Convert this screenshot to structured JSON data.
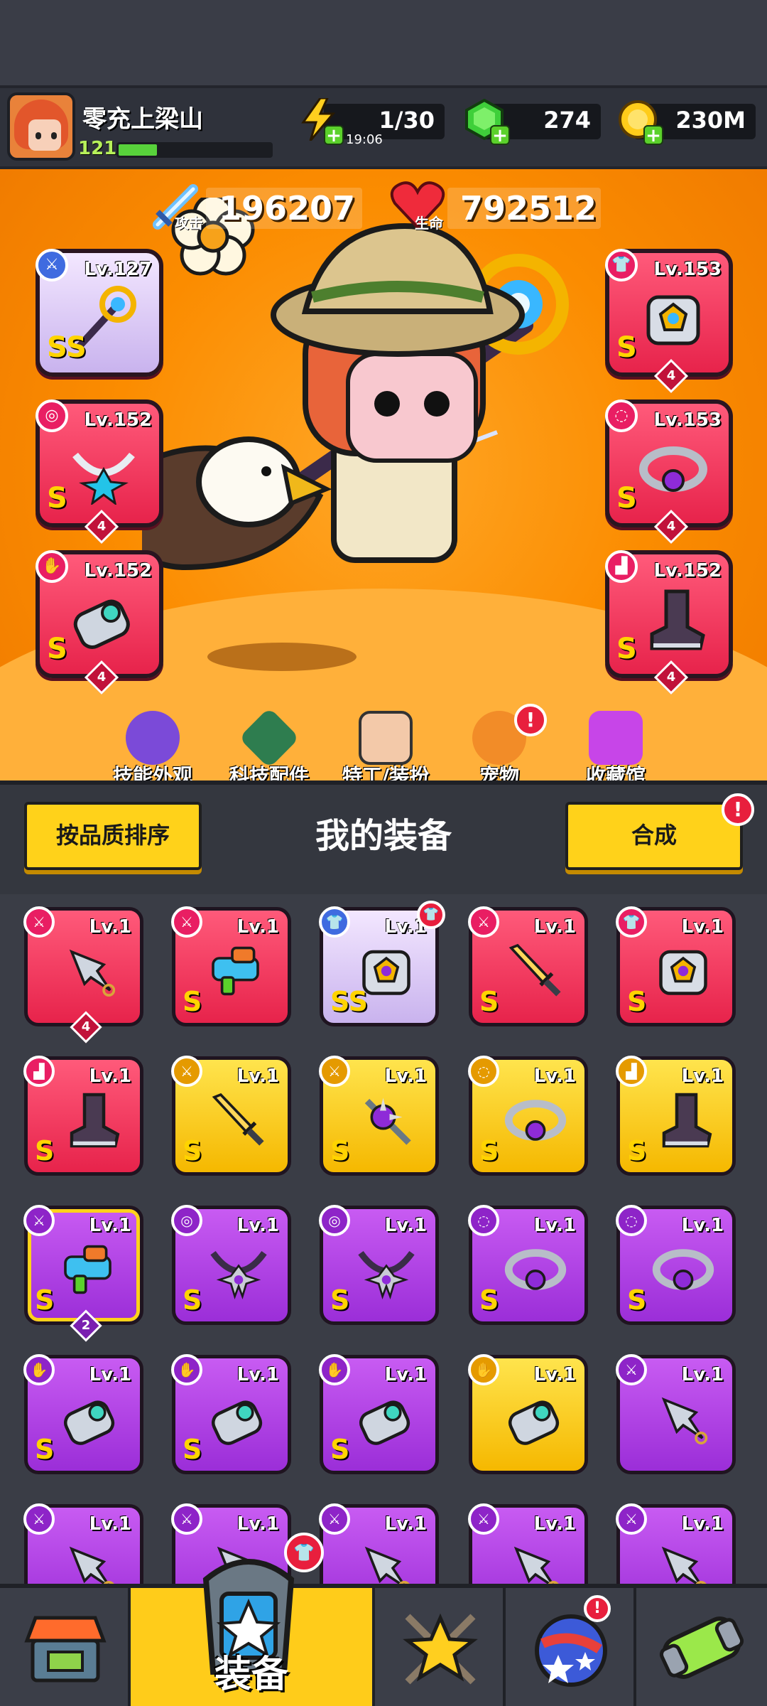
{
  "player": {
    "name": "零充上梁山",
    "level": "121",
    "xp_fraction": 0.25
  },
  "resources": {
    "energy": {
      "value": "1/30",
      "timer": "19:06",
      "icon": "lightning-icon"
    },
    "gems": {
      "value": "274",
      "icon": "green-gem-icon"
    },
    "coins": {
      "value": "230M",
      "icon": "gold-coin-icon"
    }
  },
  "stats": {
    "attack": {
      "label": "攻击",
      "value": "196207",
      "icon": "sword-icon"
    },
    "hp": {
      "label": "生命",
      "value": "792512",
      "icon": "heart-icon"
    }
  },
  "equipped": [
    {
      "slot": "weapon",
      "level": "Lv.127",
      "grade": "SS",
      "rarity": "lavender",
      "icon": "staff-icon",
      "stars": ""
    },
    {
      "slot": "armor",
      "level": "Lv.153",
      "grade": "S",
      "rarity": "red",
      "icon": "armor-icon",
      "stars": "4"
    },
    {
      "slot": "necklace",
      "level": "Lv.152",
      "grade": "S",
      "rarity": "red",
      "icon": "necklace-icon",
      "stars": "4"
    },
    {
      "slot": "belt",
      "level": "Lv.153",
      "grade": "S",
      "rarity": "red",
      "icon": "belt-icon",
      "stars": "4"
    },
    {
      "slot": "gloves",
      "level": "Lv.152",
      "grade": "S",
      "rarity": "red",
      "icon": "gauntlet-icon",
      "stars": "4"
    },
    {
      "slot": "boots",
      "level": "Lv.152",
      "grade": "S",
      "rarity": "red",
      "icon": "boot-icon",
      "stars": "4"
    }
  ],
  "menu": [
    {
      "label": "技能外观",
      "icon": "skill-skin-icon"
    },
    {
      "label": "科技配件",
      "icon": "tech-part-icon"
    },
    {
      "label": "特工/装扮",
      "icon": "agent-icon"
    },
    {
      "label": "宠物",
      "icon": "pet-icon",
      "badge": "!"
    },
    {
      "label": "收藏馆",
      "icon": "collection-icon"
    }
  ],
  "panel": {
    "sort_label": "按品质排序",
    "title": "我的装备",
    "merge_label": "合成",
    "merge_badge": "!"
  },
  "inventory": [
    {
      "level": "Lv.1",
      "grade": "",
      "rarity": "red",
      "type": "weapon",
      "icon": "kunai-icon",
      "qty": "4"
    },
    {
      "level": "Lv.1",
      "grade": "S",
      "rarity": "red",
      "type": "weapon",
      "icon": "blaster-icon",
      "qty": ""
    },
    {
      "level": "Lv.1",
      "grade": "SS",
      "rarity": "lavender",
      "type": "armor",
      "icon": "armor-icon",
      "qty": "",
      "badge": "armor"
    },
    {
      "level": "Lv.1",
      "grade": "S",
      "rarity": "red",
      "type": "weapon",
      "icon": "katana-icon",
      "qty": ""
    },
    {
      "level": "Lv.1",
      "grade": "S",
      "rarity": "red",
      "type": "armor",
      "icon": "armor-icon",
      "qty": ""
    },
    {
      "level": "Lv.1",
      "grade": "S",
      "rarity": "red",
      "type": "boots",
      "icon": "boot-icon",
      "qty": ""
    },
    {
      "level": "Lv.1",
      "grade": "S",
      "rarity": "gold",
      "type": "weapon",
      "icon": "katana-icon",
      "qty": ""
    },
    {
      "level": "Lv.1",
      "grade": "S",
      "rarity": "gold",
      "type": "weapon",
      "icon": "spike-staff-icon",
      "qty": ""
    },
    {
      "level": "Lv.1",
      "grade": "S",
      "rarity": "gold",
      "type": "belt",
      "icon": "belt-icon",
      "qty": ""
    },
    {
      "level": "Lv.1",
      "grade": "S",
      "rarity": "gold",
      "type": "boots",
      "icon": "boot-icon",
      "qty": ""
    },
    {
      "level": "Lv.1",
      "grade": "S",
      "rarity": "purple",
      "type": "weapon",
      "icon": "blaster-icon",
      "qty": "2",
      "selected": true
    },
    {
      "level": "Lv.1",
      "grade": "S",
      "rarity": "purple",
      "type": "necklace",
      "icon": "necklace-icon",
      "qty": ""
    },
    {
      "level": "Lv.1",
      "grade": "S",
      "rarity": "purple",
      "type": "necklace",
      "icon": "necklace-icon",
      "qty": ""
    },
    {
      "level": "Lv.1",
      "grade": "S",
      "rarity": "purple",
      "type": "belt",
      "icon": "belt-icon",
      "qty": ""
    },
    {
      "level": "Lv.1",
      "grade": "S",
      "rarity": "purple",
      "type": "belt",
      "icon": "belt-icon",
      "qty": ""
    },
    {
      "level": "Lv.1",
      "grade": "S",
      "rarity": "purple",
      "type": "gloves",
      "icon": "gauntlet-icon",
      "qty": ""
    },
    {
      "level": "Lv.1",
      "grade": "S",
      "rarity": "purple",
      "type": "gloves",
      "icon": "gauntlet-icon",
      "qty": ""
    },
    {
      "level": "Lv.1",
      "grade": "S",
      "rarity": "purple",
      "type": "gloves",
      "icon": "gauntlet-icon",
      "qty": ""
    },
    {
      "level": "Lv.1",
      "grade": "",
      "rarity": "gold",
      "type": "gloves",
      "icon": "gauntlet-icon",
      "qty": ""
    },
    {
      "level": "Lv.1",
      "grade": "",
      "rarity": "purple",
      "type": "weapon",
      "icon": "kunai-icon",
      "qty": ""
    },
    {
      "level": "Lv.1",
      "grade": "",
      "rarity": "purple",
      "type": "weapon",
      "icon": "kunai-icon",
      "qty": ""
    },
    {
      "level": "Lv.1",
      "grade": "",
      "rarity": "purple",
      "type": "weapon",
      "icon": "kunai-icon",
      "qty": ""
    },
    {
      "level": "Lv.1",
      "grade": "",
      "rarity": "purple",
      "type": "weapon",
      "icon": "kunai-icon",
      "qty": ""
    },
    {
      "level": "Lv.1",
      "grade": "",
      "rarity": "purple",
      "type": "weapon",
      "icon": "kunai-icon",
      "qty": ""
    },
    {
      "level": "Lv.1",
      "grade": "",
      "rarity": "purple",
      "type": "weapon",
      "icon": "kunai-icon",
      "qty": ""
    }
  ],
  "nav": [
    {
      "id": "shop",
      "icon": "shop-icon",
      "label": ""
    },
    {
      "id": "equipment",
      "icon": "equipment-icon",
      "label": "装备",
      "active": true,
      "badge": "armor"
    },
    {
      "id": "talent",
      "icon": "star-swords-icon",
      "label": ""
    },
    {
      "id": "world",
      "icon": "planet-icon",
      "label": "",
      "badge": "!"
    },
    {
      "id": "lab",
      "icon": "dna-capsule-icon",
      "label": ""
    }
  ],
  "colors": {
    "accent": "#ffd21a",
    "red_rarity": "#e7234b",
    "gold_rarity": "#f5b800",
    "purple_rarity": "#9b2ed8",
    "lavender_rarity": "#c9b3ee",
    "hero_bg": "#fb8c00"
  }
}
